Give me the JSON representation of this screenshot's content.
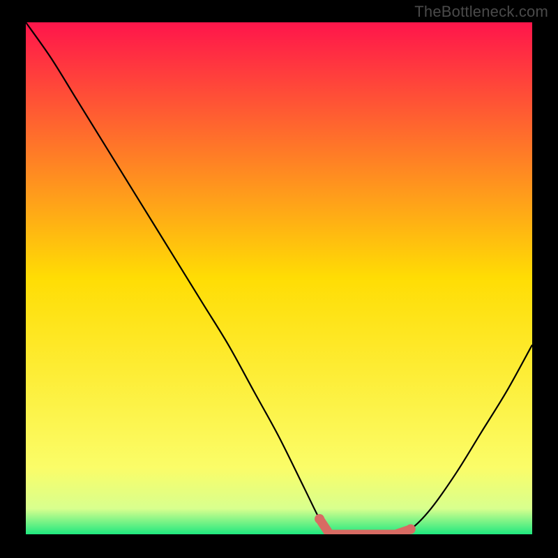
{
  "attribution": "TheBottleneck.com",
  "chart_data": {
    "type": "line",
    "title": "",
    "xlabel": "",
    "ylabel": "",
    "xlim": [
      0,
      100
    ],
    "ylim": [
      0,
      100
    ],
    "x": [
      0,
      5,
      10,
      15,
      20,
      25,
      30,
      35,
      40,
      45,
      50,
      55,
      58,
      60,
      63,
      66,
      70,
      73,
      76,
      80,
      85,
      90,
      95,
      100
    ],
    "series": [
      {
        "name": "bottleneck-curve",
        "values": [
          100,
          93,
          85,
          77,
          69,
          61,
          53,
          45,
          37,
          28,
          19,
          9,
          3,
          0,
          0,
          0,
          0,
          0,
          1,
          5,
          12,
          20,
          28,
          37
        ]
      }
    ],
    "highlight": {
      "name": "optimal-range",
      "x_range": [
        58,
        76
      ],
      "values_at_range": [
        3,
        0,
        0,
        0,
        0,
        0,
        1
      ],
      "color": "#d86b63"
    },
    "background": {
      "type": "vertical-gradient",
      "stops": [
        {
          "pos": 0,
          "color": "#ff154b"
        },
        {
          "pos": 50,
          "color": "#ffdd04"
        },
        {
          "pos": 87,
          "color": "#fbfd68"
        },
        {
          "pos": 95,
          "color": "#d8ff8e"
        },
        {
          "pos": 100,
          "color": "#1fe87f"
        }
      ]
    }
  }
}
